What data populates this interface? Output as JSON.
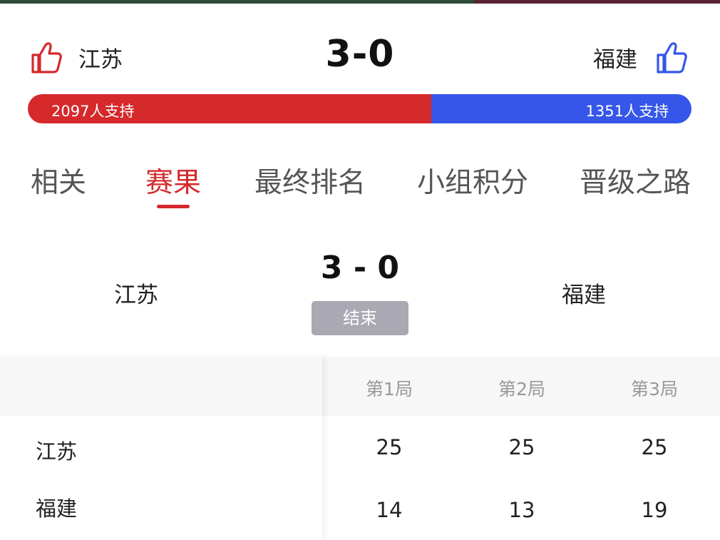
{
  "colors": {
    "home": "#d5292b",
    "away": "#3556e8",
    "status_badge": "#a9a8b3"
  },
  "header": {
    "home_team": "江苏",
    "away_team": "福建",
    "score": "3-0",
    "home_icon": "thumbs-up-icon",
    "away_icon": "thumbs-up-icon"
  },
  "support": {
    "home_label": "2097人支持",
    "away_label": "1351人支持",
    "home_count": 2097,
    "away_count": 1351
  },
  "tabs": [
    {
      "label": "相关"
    },
    {
      "label": "赛果",
      "active": true
    },
    {
      "label": "最终排名"
    },
    {
      "label": "小组积分"
    },
    {
      "label": "晋级之路"
    }
  ],
  "match": {
    "home_team": "江苏",
    "away_team": "福建",
    "score": "3 - 0",
    "status": "结束"
  },
  "sets": {
    "headers": [
      "第1局",
      "第2局",
      "第3局"
    ],
    "rows": [
      {
        "team": "江苏",
        "scores": [
          "25",
          "25",
          "25"
        ]
      },
      {
        "team": "福建",
        "scores": [
          "14",
          "13",
          "19"
        ]
      }
    ]
  }
}
